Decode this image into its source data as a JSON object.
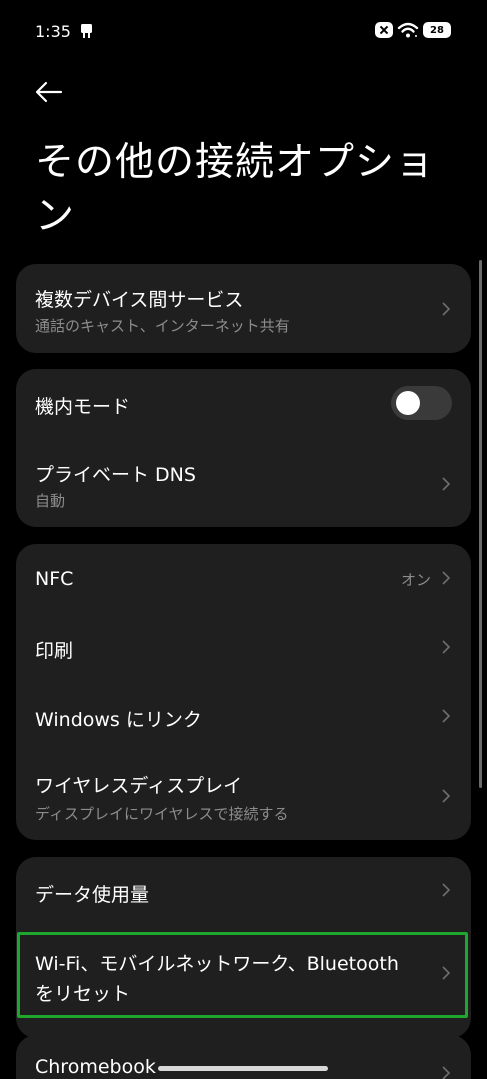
{
  "status_bar": {
    "time": "1:35",
    "battery": "28"
  },
  "header": {
    "title": "その他の接続オプション"
  },
  "cards": {
    "multi_device": {
      "title": "複数デバイス間サービス",
      "subtitle": "通話のキャスト、インターネット共有"
    },
    "airplane": {
      "title": "機内モード",
      "enabled": false
    },
    "private_dns": {
      "title": "プライベート DNS",
      "subtitle": "自動"
    },
    "nfc": {
      "title": "NFC",
      "value": "オン"
    },
    "print": {
      "title": "印刷"
    },
    "windows_link": {
      "title": "Windows にリンク"
    },
    "wireless_display": {
      "title": "ワイヤレスディスプレイ",
      "subtitle": "ディスプレイにワイヤレスで接続する"
    },
    "data_usage": {
      "title": "データ使用量"
    },
    "reset_network": {
      "line1": "Wi-Fi、モバイルネットワーク、Bluetooth",
      "line2": "をリセット"
    },
    "chromebook": {
      "title": "Chromebook"
    }
  },
  "colors": {
    "background": "#000000",
    "card": "#1f1f1f",
    "highlight": "#1fa62e",
    "secondary_text": "#8c8c8c"
  },
  "icons": [
    "back-arrow-icon",
    "chevron-right-icon",
    "wifi-icon",
    "battery-icon"
  ]
}
